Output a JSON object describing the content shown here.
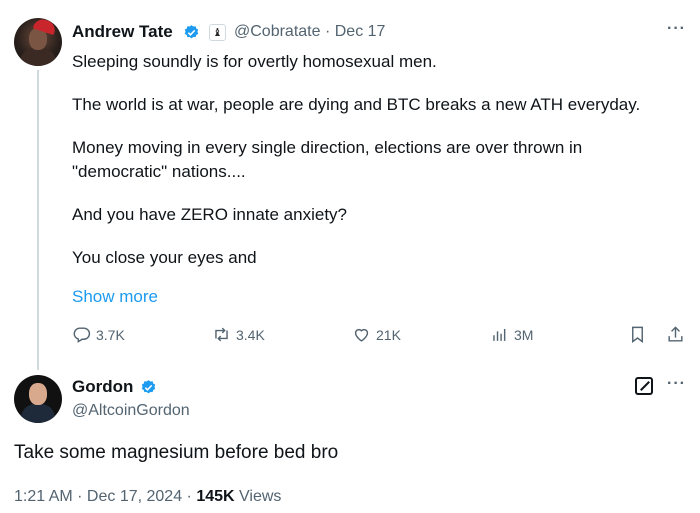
{
  "original_tweet": {
    "author_name": "Andrew Tate",
    "handle": "@Cobratate",
    "date": "Dec 17",
    "badge_glyph": "♝",
    "lines": [
      "Sleeping soundly is for overtly homosexual men.",
      "The world is at war, people are dying and BTC breaks a new ATH everyday.",
      "Money moving in every single direction, elections are over thrown in",
      "\"democratic\" nations....",
      "And you have ZERO innate anxiety?",
      "You close your eyes and"
    ],
    "show_more": "Show more",
    "stats": {
      "replies": "3.7K",
      "reposts": "3.4K",
      "likes": "21K",
      "views": "3M"
    }
  },
  "reply_tweet": {
    "author_name": "Gordon",
    "handle": "@AltcoinGordon",
    "text": "Take some magnesium before bed bro",
    "time": "1:21 AM",
    "date": "Dec 17, 2024",
    "views_count": "145K",
    "views_label": "Views"
  },
  "colors": {
    "accent": "#1d9bf0",
    "secondary_text": "#536471",
    "primary_text": "#0f1419",
    "thread_line": "#cfd9de"
  },
  "icons": [
    "reply-icon",
    "repost-icon",
    "like-icon",
    "views-icon",
    "bookmark-icon",
    "share-icon",
    "more-icon",
    "verified-icon",
    "edit-icon"
  ]
}
